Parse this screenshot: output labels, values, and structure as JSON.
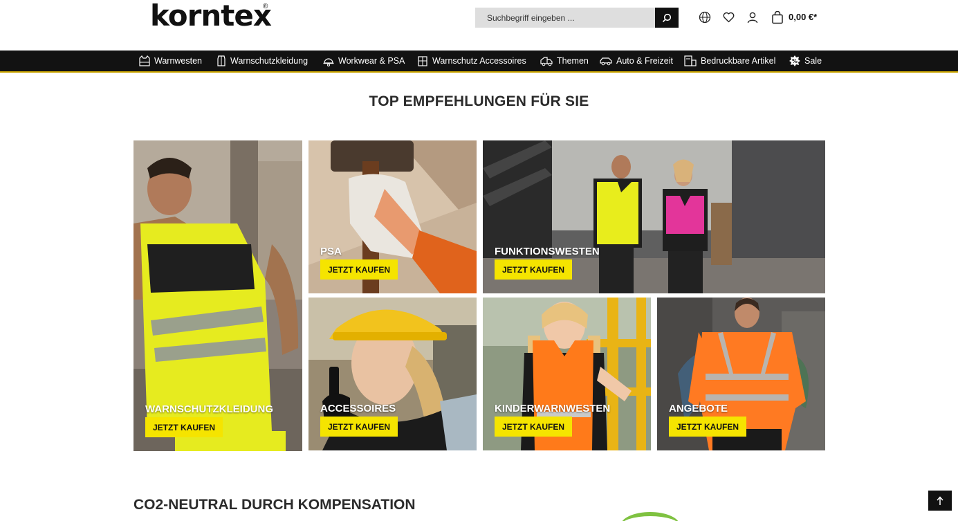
{
  "header": {
    "logo_text": "korntex",
    "logo_reg": "®",
    "search": {
      "placeholder": "Suchbegriff eingeben ..."
    },
    "cart_total": "0,00 €*",
    "icons": [
      "search-icon",
      "globe-icon",
      "heart-icon",
      "user-icon",
      "cart-icon"
    ]
  },
  "nav": {
    "items": [
      {
        "label": "Warnwesten",
        "icon": "vest-icon"
      },
      {
        "label": "Warnschutzkleidung",
        "icon": "clothing-icon"
      },
      {
        "label": "Workwear & PSA",
        "icon": "helmet-icon"
      },
      {
        "label": "Warnschutz Accessoires",
        "icon": "accessories-icon"
      },
      {
        "label": "Themen",
        "icon": "truck-icon"
      },
      {
        "label": "Auto & Freizeit",
        "icon": "car-icon"
      },
      {
        "label": "Bedruckbare Artikel",
        "icon": "print-icon"
      },
      {
        "label": "Sale",
        "icon": "sale-badge-icon"
      }
    ]
  },
  "recommendations": {
    "title": "TOP EMPFEHLUNGEN FÜR SIE",
    "tiles": [
      {
        "label": "WARNSCHUTZKLEIDUNG",
        "button": "JETZT KAUFEN"
      },
      {
        "label": "PSA",
        "button": "JETZT KAUFEN"
      },
      {
        "label": "FUNKTIONSWESTEN",
        "button": "JETZT KAUFEN"
      },
      {
        "label": "ACCESSOIRES",
        "button": "JETZT KAUFEN"
      },
      {
        "label": "KINDERWARNWESTEN",
        "button": "JETZT KAUFEN"
      },
      {
        "label": "ANGEBOTE",
        "button": "JETZT KAUFEN"
      }
    ]
  },
  "co2": {
    "title": "CO2-NEUTRAL DURCH KOMPENSATION"
  },
  "colors": {
    "accent": "#f5e400",
    "nav_bg": "#121212",
    "eco_green": "#7fc241"
  }
}
